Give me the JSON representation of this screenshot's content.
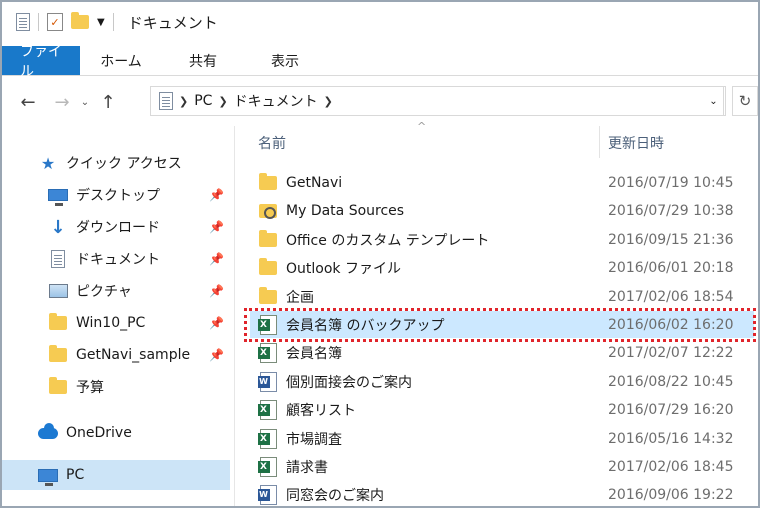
{
  "window": {
    "title": "ドキュメント"
  },
  "ribbon": {
    "tabs": [
      "ファイル",
      "ホーム",
      "共有",
      "表示"
    ]
  },
  "address": {
    "crumbs": [
      "PC",
      "ドキュメント"
    ]
  },
  "nav": {
    "quick_access": "クイック アクセス",
    "items": [
      {
        "label": "デスクトップ",
        "icon": "desktop-icon",
        "pinned": true
      },
      {
        "label": "ダウンロード",
        "icon": "download-icon",
        "pinned": true
      },
      {
        "label": "ドキュメント",
        "icon": "documents-icon",
        "pinned": true
      },
      {
        "label": "ピクチャ",
        "icon": "pictures-icon",
        "pinned": true
      },
      {
        "label": "Win10_PC",
        "icon": "folder-icon",
        "pinned": true
      },
      {
        "label": "GetNavi_sample",
        "icon": "folder-icon",
        "pinned": true
      },
      {
        "label": "予算",
        "icon": "folder-icon",
        "pinned": false
      }
    ],
    "onedrive": "OneDrive",
    "pc": "PC"
  },
  "list": {
    "columns": {
      "name": "名前",
      "date": "更新日時"
    },
    "files": [
      {
        "name": "GetNavi",
        "date": "2016/07/19 10:45",
        "icon": "folder-icon"
      },
      {
        "name": "My Data Sources",
        "date": "2016/07/29 10:38",
        "icon": "data-source-folder-icon"
      },
      {
        "name": "Office のカスタム テンプレート",
        "date": "2016/09/15 21:36",
        "icon": "folder-icon"
      },
      {
        "name": "Outlook ファイル",
        "date": "2016/06/01 20:18",
        "icon": "folder-icon"
      },
      {
        "name": "企画",
        "date": "2017/02/06 18:54",
        "icon": "folder-icon"
      },
      {
        "name": "会員名簿 のバックアップ",
        "date": "2016/06/02 16:20",
        "icon": "excel-file-icon",
        "highlighted": true
      },
      {
        "name": "会員名簿",
        "date": "2017/02/07 12:22",
        "icon": "excel-file-icon"
      },
      {
        "name": "個別面接会のご案内",
        "date": "2016/08/22 10:45",
        "icon": "word-file-icon"
      },
      {
        "name": "顧客リスト",
        "date": "2016/07/29 16:20",
        "icon": "excel-file-icon"
      },
      {
        "name": "市場調査",
        "date": "2016/05/16 14:32",
        "icon": "excel-file-icon"
      },
      {
        "name": "請求書",
        "date": "2017/02/06 18:45",
        "icon": "excel-file-icon"
      },
      {
        "name": "同窓会のご案内",
        "date": "2016/09/06 19:22",
        "icon": "word-file-icon"
      }
    ]
  },
  "colors": {
    "file_tab": "#1979ca",
    "highlight_row": "#cce8ff",
    "annotation_border": "#e0242b"
  }
}
